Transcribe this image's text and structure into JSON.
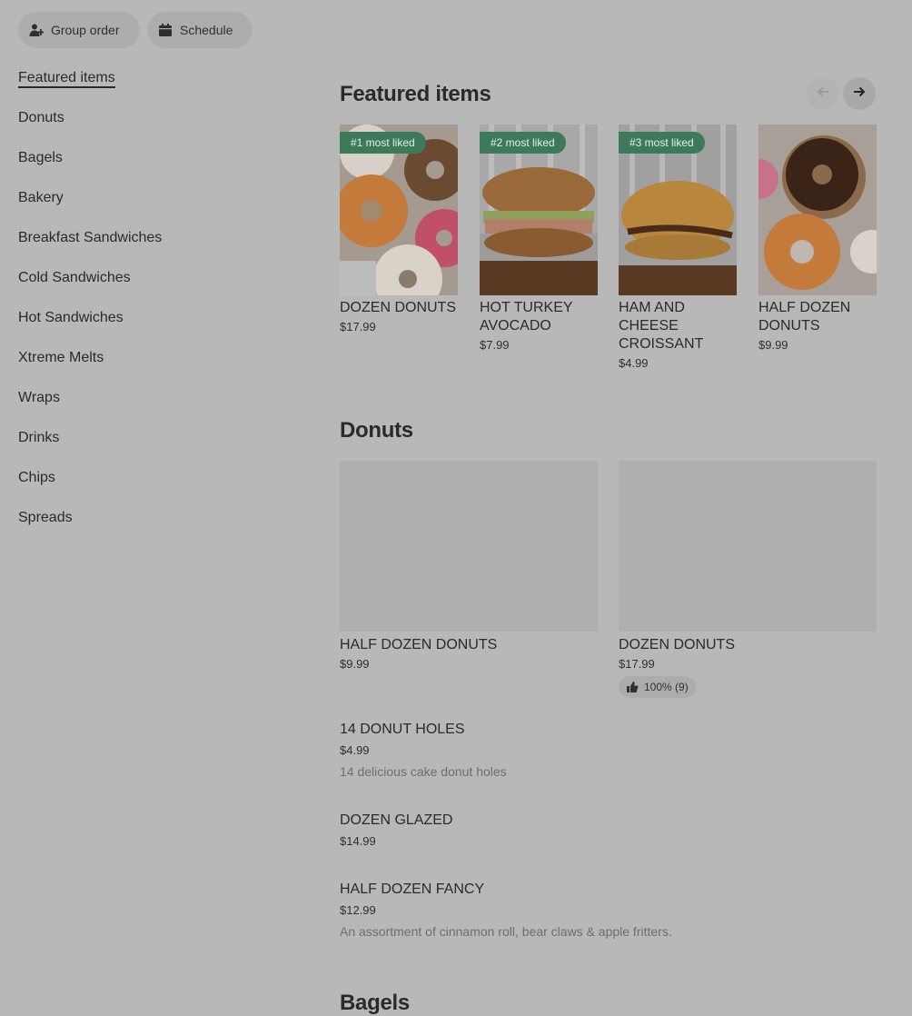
{
  "header": {
    "group_order_label": "Group order",
    "schedule_label": "Schedule"
  },
  "sidebar": {
    "items": [
      {
        "label": "Featured items"
      },
      {
        "label": "Donuts"
      },
      {
        "label": "Bagels"
      },
      {
        "label": "Bakery"
      },
      {
        "label": "Breakfast Sandwiches"
      },
      {
        "label": "Cold Sandwiches"
      },
      {
        "label": "Hot Sandwiches"
      },
      {
        "label": "Xtreme Melts"
      },
      {
        "label": "Wraps"
      },
      {
        "label": "Drinks"
      },
      {
        "label": "Chips"
      },
      {
        "label": "Spreads"
      }
    ]
  },
  "featured": {
    "title": "Featured items",
    "items": [
      {
        "badge": "#1 most liked",
        "name": "DOZEN DONUTS",
        "price": "$17.99",
        "image": "donut-assortment"
      },
      {
        "badge": "#2 most liked",
        "name": "HOT TURKEY AVOCADO",
        "price": "$7.99",
        "image": "bagel-sandwich"
      },
      {
        "badge": "#3 most liked",
        "name": "HAM AND CHEESE CROISSANT",
        "price": "$4.99",
        "image": "croissant"
      },
      {
        "badge": "",
        "name": "HALF DOZEN DONUTS",
        "price": "$9.99",
        "image": "chocolate-donuts"
      }
    ]
  },
  "donuts": {
    "title": "Donuts",
    "grid_items": [
      {
        "name": "HALF DOZEN DONUTS",
        "price": "$9.99",
        "rating": ""
      },
      {
        "name": "DOZEN DONUTS",
        "price": "$17.99",
        "rating": "100% (9)"
      }
    ],
    "list_items": [
      {
        "name": "14 DONUT HOLES",
        "price": "$4.99",
        "description": "14 delicious cake donut holes"
      },
      {
        "name": "DOZEN GLAZED",
        "price": "$14.99",
        "description": ""
      },
      {
        "name": "HALF DOZEN FANCY",
        "price": "$12.99",
        "description": "An assortment of cinnamon roll, bear claws & apple fritters."
      }
    ]
  },
  "next_section": {
    "title": "Bagels"
  },
  "colors": {
    "overlay_bg": "#b8b8b8",
    "badge_green": "#3d7a5a"
  }
}
